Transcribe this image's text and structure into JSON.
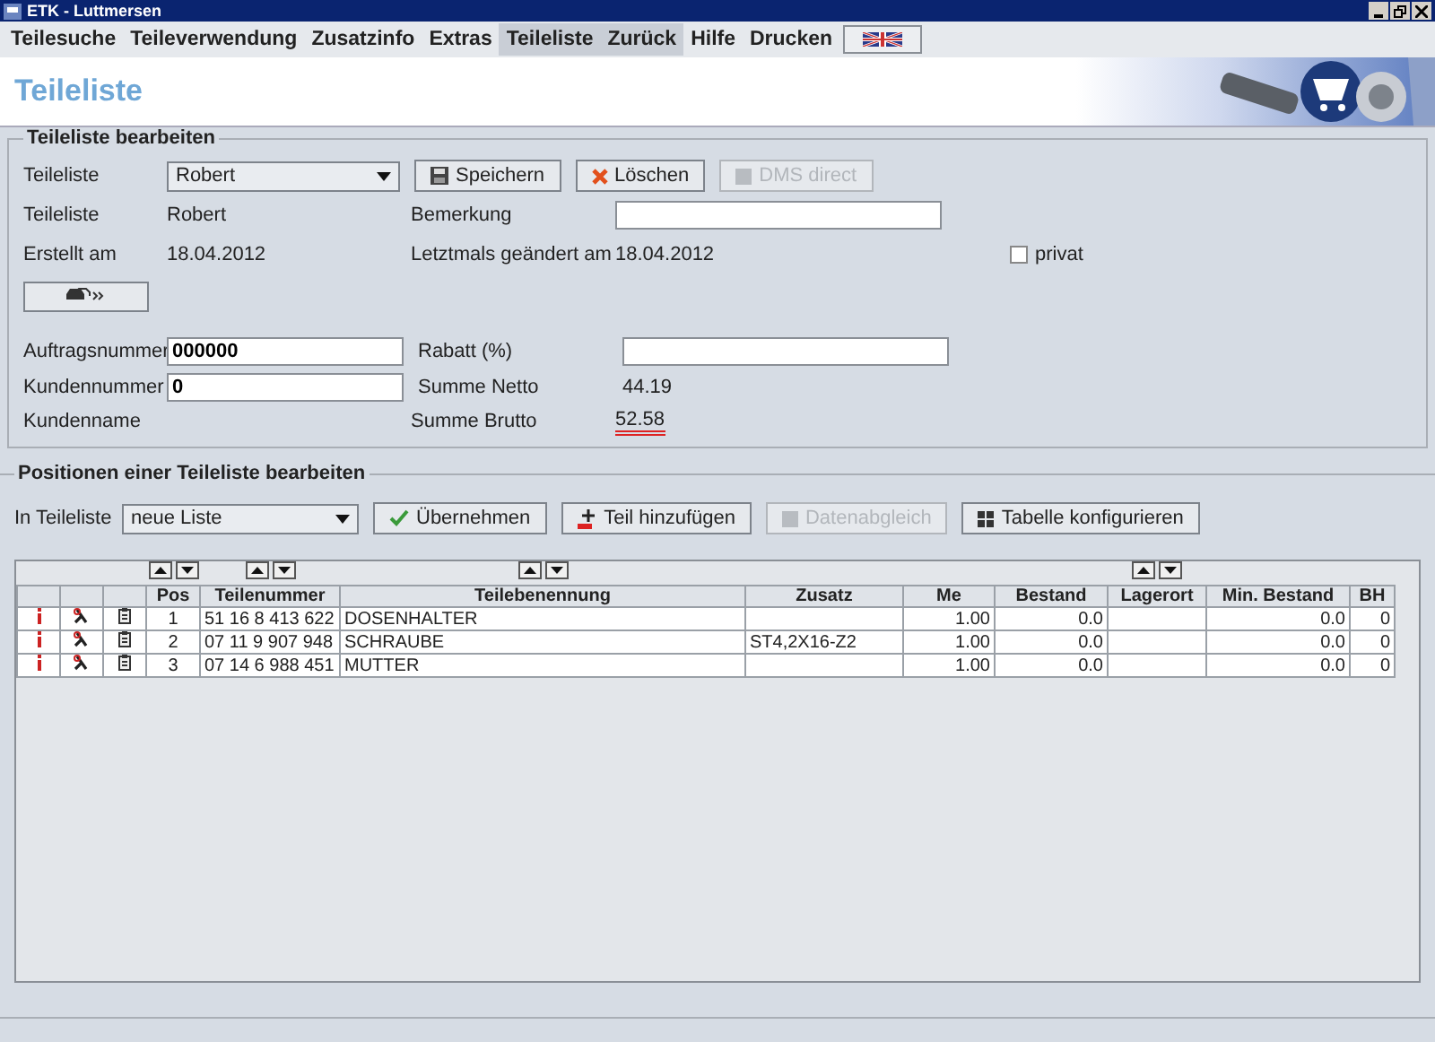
{
  "window": {
    "title": "ETK - Luttmersen"
  },
  "menu": [
    {
      "label": "Teilesuche",
      "highlighted": false
    },
    {
      "label": "Teileverwendung",
      "highlighted": false
    },
    {
      "label": "Zusatzinfo",
      "highlighted": false
    },
    {
      "label": "Extras",
      "highlighted": false
    },
    {
      "label": "Teileliste",
      "highlighted": true
    },
    {
      "label": "Zurück",
      "highlighted": true
    },
    {
      "label": "Hilfe",
      "highlighted": false
    },
    {
      "label": "Drucken",
      "highlighted": false
    }
  ],
  "page_title": "Teileliste",
  "edit_section": {
    "title": "Teileliste bearbeiten",
    "list_label": "Teileliste",
    "list_value": "Robert",
    "buttons": [
      {
        "label": "Speichern",
        "disabled": false
      },
      {
        "label": "Löschen",
        "disabled": false
      },
      {
        "label": "DMS direct",
        "disabled": true
      }
    ],
    "info": [
      {
        "label": "Teileliste",
        "value": "Robert"
      },
      {
        "label": "Erstellt am",
        "value": "18.04.2012"
      }
    ],
    "remark_label": "Bemerkung",
    "changed_label": "Letztmals geändert am",
    "changed_value": "18.04.2012",
    "privat": {
      "label": "privat",
      "checked": false
    },
    "order_label": "Auftragsnummer",
    "order_value": "000000",
    "customer_label": "Kundennummer",
    "customer_value": "0",
    "customer_name_label": "Kundenname",
    "discount_label": "Rabatt (%)",
    "net_label": "Summe Netto",
    "net_value": "44.19",
    "gross_label": "Summe Brutto",
    "gross_value": "52.58"
  },
  "positions_section": {
    "title": "Positionen einer Teileliste bearbeiten",
    "target_label": "In Teileliste",
    "target_value": "neue Liste",
    "buttons": [
      {
        "label": "Übernehmen",
        "disabled": false
      },
      {
        "label": "Teil hinzufügen",
        "disabled": false
      },
      {
        "label": "Datenabgleich",
        "disabled": true
      },
      {
        "label": "Tabelle konfigurieren",
        "disabled": false
      }
    ],
    "table": {
      "columns": [
        {
          "label": "Pos",
          "sortable": true
        },
        {
          "label": "Teilenummer",
          "sortable": true
        },
        {
          "label": "Teilebenennung",
          "sortable": true
        },
        {
          "label": "Zusatz",
          "sortable": false
        },
        {
          "label": "Me",
          "sortable": false
        },
        {
          "label": "Bestand",
          "sortable": false
        },
        {
          "label": "Lagerort",
          "sortable": true
        },
        {
          "label": "Min. Bestand",
          "sortable": false
        },
        {
          "label": "BH",
          "sortable": false
        }
      ],
      "rows": [
        {
          "cells": [
            "1",
            "51 16 8 413 622",
            "DOSENHALTER",
            "",
            "1.00",
            "0.0",
            "",
            "0.0",
            "0"
          ]
        },
        {
          "cells": [
            "2",
            "07 11 9 907 948",
            "SCHRAUBE",
            "ST4,2X16-Z2",
            "1.00",
            "0.0",
            "",
            "0.0",
            "0"
          ]
        },
        {
          "cells": [
            "3",
            "07 14 6 988 451",
            "MUTTER",
            "",
            "1.00",
            "0.0",
            "",
            "0.0",
            "0"
          ]
        }
      ]
    }
  }
}
